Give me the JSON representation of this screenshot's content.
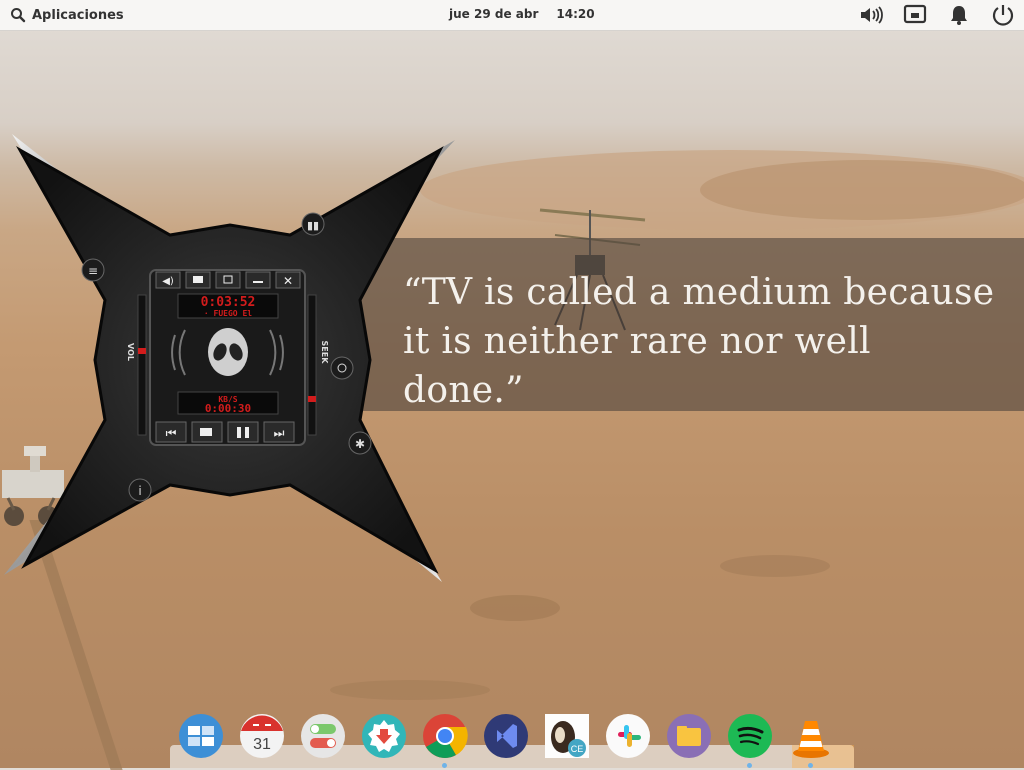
{
  "top_panel": {
    "apps_label": "Aplicaciones",
    "date": "jue 29 de abr",
    "time": "14:20",
    "indicators": [
      "volume-icon",
      "network-icon",
      "notifications-icon",
      "power-icon"
    ]
  },
  "wallpaper": {
    "quote": "“TV is called a medium because it is neither rare nor well done.”"
  },
  "player": {
    "time_display": "0:03:52",
    "track": "· FUEGO El",
    "rate": "KB/S",
    "elapsed": "0:00:30",
    "vol_label": "VOL",
    "seek_label": "SEEK",
    "titlebar_buttons": [
      "speaker-icon",
      "folder-icon",
      "restore-icon",
      "minimize-icon",
      "close-icon"
    ],
    "transport_buttons": [
      "previous-icon",
      "stop-icon",
      "pause-icon",
      "next-icon"
    ]
  },
  "dock": {
    "items": [
      {
        "name": "multitasking-view",
        "running": false
      },
      {
        "name": "calendar",
        "label": "31",
        "running": false
      },
      {
        "name": "system-settings",
        "running": false
      },
      {
        "name": "appcenter",
        "running": false
      },
      {
        "name": "google-chrome",
        "running": true
      },
      {
        "name": "visual-studio",
        "running": false
      },
      {
        "name": "cheat-engine",
        "label": "CE",
        "running": false
      },
      {
        "name": "slack",
        "running": false
      },
      {
        "name": "files",
        "running": false
      },
      {
        "name": "spotify",
        "running": true
      },
      {
        "name": "vlc",
        "running": true
      }
    ]
  }
}
